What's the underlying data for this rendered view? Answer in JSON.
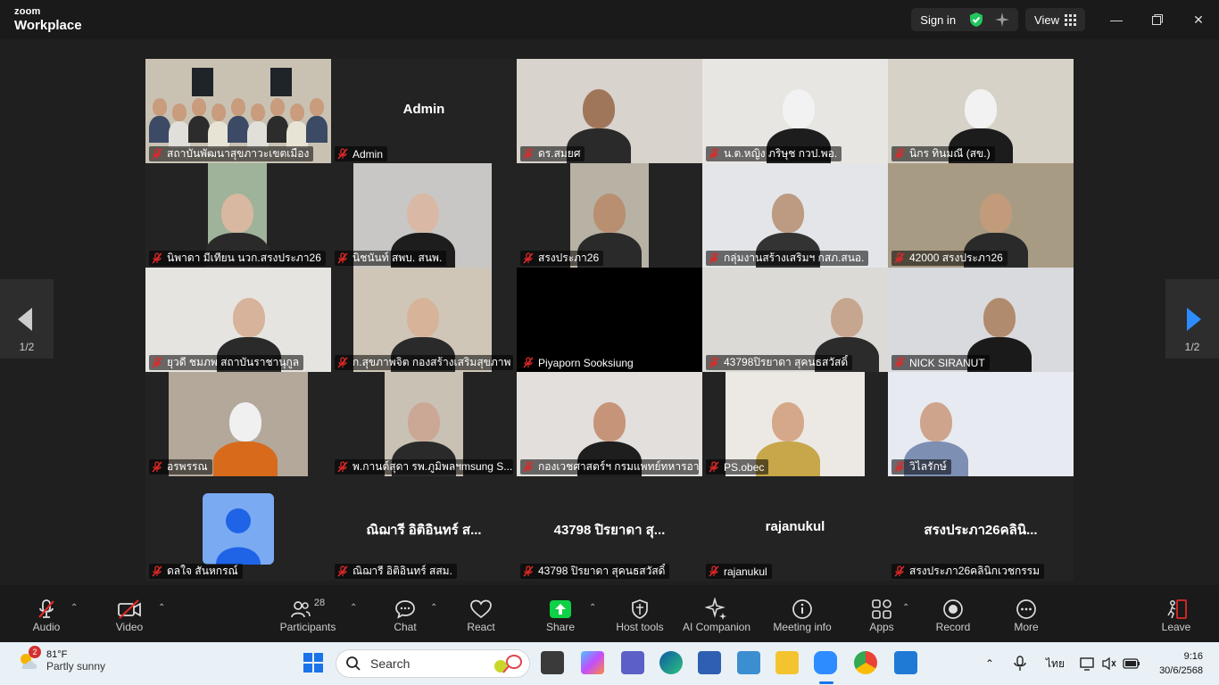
{
  "app": {
    "logo_line1": "zoom",
    "logo_line2": "Workplace"
  },
  "titlebar": {
    "sign_in": "Sign in",
    "view": "View"
  },
  "participants": [
    {
      "name": "สถาบันพัฒนาสุขภาวะเขตเมือง",
      "video": true,
      "active": true
    },
    {
      "name": "Admin",
      "video": false,
      "display_name": "Admin"
    },
    {
      "name": "ดร.สมยศ",
      "video": true
    },
    {
      "name": "น.ต.หญิง ภริษุช กวป.พอ.",
      "video": true
    },
    {
      "name": "นิกร ทินมณี (สข.)",
      "video": true
    },
    {
      "name": "นิพาดา มีเทียน นวก.สรงประภา26",
      "video": true
    },
    {
      "name": "นิชนันท์ สพบ. สนพ.",
      "video": true
    },
    {
      "name": "สรงประภา26",
      "video": true
    },
    {
      "name": "กลุ่มงานสร้างเสริมฯ กสภ.สนอ.",
      "video": true
    },
    {
      "name": "42000 สรงประภา26",
      "video": true
    },
    {
      "name": "ยุวดี ชมภพ สถาบันราชานุกูล",
      "video": true
    },
    {
      "name": "ก.สุขภาพจิต กองสร้างเสริมสุขภาพ",
      "video": true
    },
    {
      "name": "Piyaporn Sooksiung",
      "video": true,
      "dark": true
    },
    {
      "name": "43798ปิรยาดา สุคนธสวัสดิ์",
      "video": true
    },
    {
      "name": "NICK SIRANUT",
      "video": true
    },
    {
      "name": "อรพรรณ",
      "video": true
    },
    {
      "name": "พ.กานต์สุดา รพ.ภูมิพลฯmsung S...",
      "video": true
    },
    {
      "name": "กองเวชศาสตร์ฯ กรมแพทย์ทหารอา...",
      "video": true
    },
    {
      "name": "PS.obec",
      "video": true
    },
    {
      "name": "วิไลรักษ์",
      "video": true
    },
    {
      "name": "ดลใจ สันหกรณ์",
      "video": false,
      "avatar": true
    },
    {
      "name": "ณิฌารี อิติอินทร์ สสม.",
      "video": false,
      "display_name": "ณิฌารี อิติอินทร์ ส..."
    },
    {
      "name": "43798 ปิรยาดา สุคนธสวัสดิ์",
      "video": false,
      "display_name": "43798 ปิรยาดา สุ..."
    },
    {
      "name": "rajanukul",
      "video": false,
      "display_name": "rajanukul"
    },
    {
      "name": "สรงประภา26คลินิกเวชกรรม",
      "video": false,
      "display_name": "สรงประภา26คลินิ..."
    }
  ],
  "pager": {
    "left": "1/2",
    "right": "1/2"
  },
  "toolbar": {
    "audio": "Audio",
    "video": "Video",
    "participants": "Participants",
    "participants_count": "28",
    "chat": "Chat",
    "react": "React",
    "share": "Share",
    "host_tools": "Host tools",
    "ai_companion": "AI Companion",
    "meeting_info": "Meeting info",
    "apps": "Apps",
    "record": "Record",
    "more": "More",
    "leave": "Leave"
  },
  "taskbar": {
    "temp": "81°F",
    "weather": "Partly sunny",
    "weather_badge": "2",
    "search_placeholder": "Search",
    "lang": "ไทย",
    "time": "9:16",
    "date": "30/6/2568"
  },
  "colors": {
    "accent_green": "#3ddc84",
    "share_green": "#0ed145",
    "mute_red": "#e02828",
    "leave_red": "#e02828"
  }
}
